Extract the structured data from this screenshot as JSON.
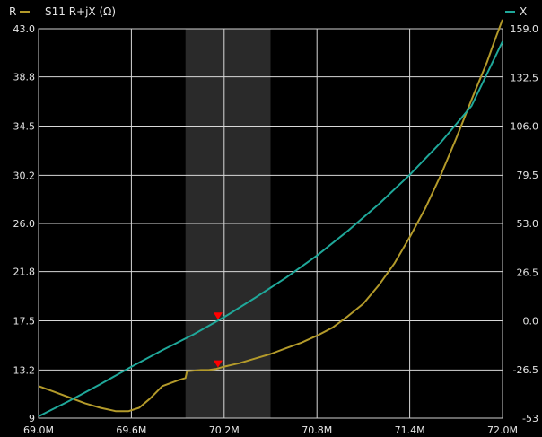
{
  "chart_data": {
    "type": "line",
    "title": "S11 R+jX (Ω)",
    "x_axis": {
      "unit": "Hz",
      "range": [
        69.0,
        72.0
      ],
      "tick_values": [
        69.0,
        69.6,
        70.2,
        70.8,
        71.4,
        72.0
      ],
      "tick_labels": [
        "69.0M",
        "69.6M",
        "70.2M",
        "70.8M",
        "71.4M",
        "72.0M"
      ]
    },
    "y_left": {
      "label": "R",
      "range": [
        9,
        43.0
      ],
      "tick_values": [
        9,
        13.2,
        17.5,
        21.8,
        26.0,
        30.2,
        34.5,
        38.8,
        43.0
      ],
      "tick_labels": [
        "9",
        "13.2",
        "17.5",
        "21.8",
        "26.0",
        "30.2",
        "34.5",
        "38.8",
        "43.0"
      ]
    },
    "y_right": {
      "label": "X",
      "range": [
        -53,
        159.0
      ],
      "tick_values": [
        -53,
        -26.5,
        0.0,
        26.5,
        53.0,
        79.5,
        106.0,
        132.5,
        159.0
      ],
      "tick_labels": [
        "-53",
        "-26.5",
        "0.0",
        "26.5",
        "53.0",
        "79.5",
        "106.0",
        "132.5",
        "159.0"
      ]
    },
    "highlight_band": {
      "x_range": [
        69.95,
        70.5
      ],
      "color": "#2a2a2a"
    },
    "grid": true,
    "legend": {
      "left": "R",
      "right": "X",
      "placement": "top"
    },
    "series": [
      {
        "name": "R",
        "axis": "left",
        "color": "#b39a2a",
        "x": [
          69.0,
          69.1,
          69.2,
          69.3,
          69.4,
          69.5,
          69.58,
          69.65,
          69.72,
          69.8,
          69.9,
          69.95,
          69.96,
          70.05,
          70.1,
          70.15,
          70.2,
          70.3,
          70.4,
          70.5,
          70.6,
          70.7,
          70.8,
          70.9,
          71.0,
          71.1,
          71.2,
          71.3,
          71.4,
          71.5,
          71.6,
          71.7,
          71.8,
          71.9,
          71.95,
          72.0
        ],
        "y": [
          11.8,
          11.3,
          10.8,
          10.3,
          9.9,
          9.6,
          9.6,
          9.9,
          10.7,
          11.8,
          12.3,
          12.5,
          13.1,
          13.2,
          13.2,
          13.3,
          13.5,
          13.8,
          14.2,
          14.6,
          15.1,
          15.6,
          16.2,
          16.9,
          17.9,
          19.0,
          20.6,
          22.5,
          24.8,
          27.3,
          30.2,
          33.4,
          36.8,
          40.1,
          42.0,
          43.8
        ]
      },
      {
        "name": "X",
        "axis": "right",
        "color": "#1fa89a",
        "x": [
          69.0,
          69.2,
          69.4,
          69.6,
          69.8,
          70.0,
          70.2,
          70.4,
          70.6,
          70.8,
          71.0,
          71.2,
          71.4,
          71.6,
          71.8,
          72.0
        ],
        "y": [
          -52.0,
          -43.5,
          -34.5,
          -25.0,
          -16.0,
          -7.5,
          2.0,
          12.5,
          23.5,
          35.5,
          49.0,
          63.5,
          79.5,
          97.0,
          117.0,
          152.0
        ]
      }
    ],
    "markers": [
      {
        "series": "X",
        "x": 70.16,
        "color": "#ff0000",
        "shape": "triangle-down"
      },
      {
        "series": "R",
        "x": 70.16,
        "color": "#ff0000",
        "shape": "triangle-down"
      }
    ]
  }
}
